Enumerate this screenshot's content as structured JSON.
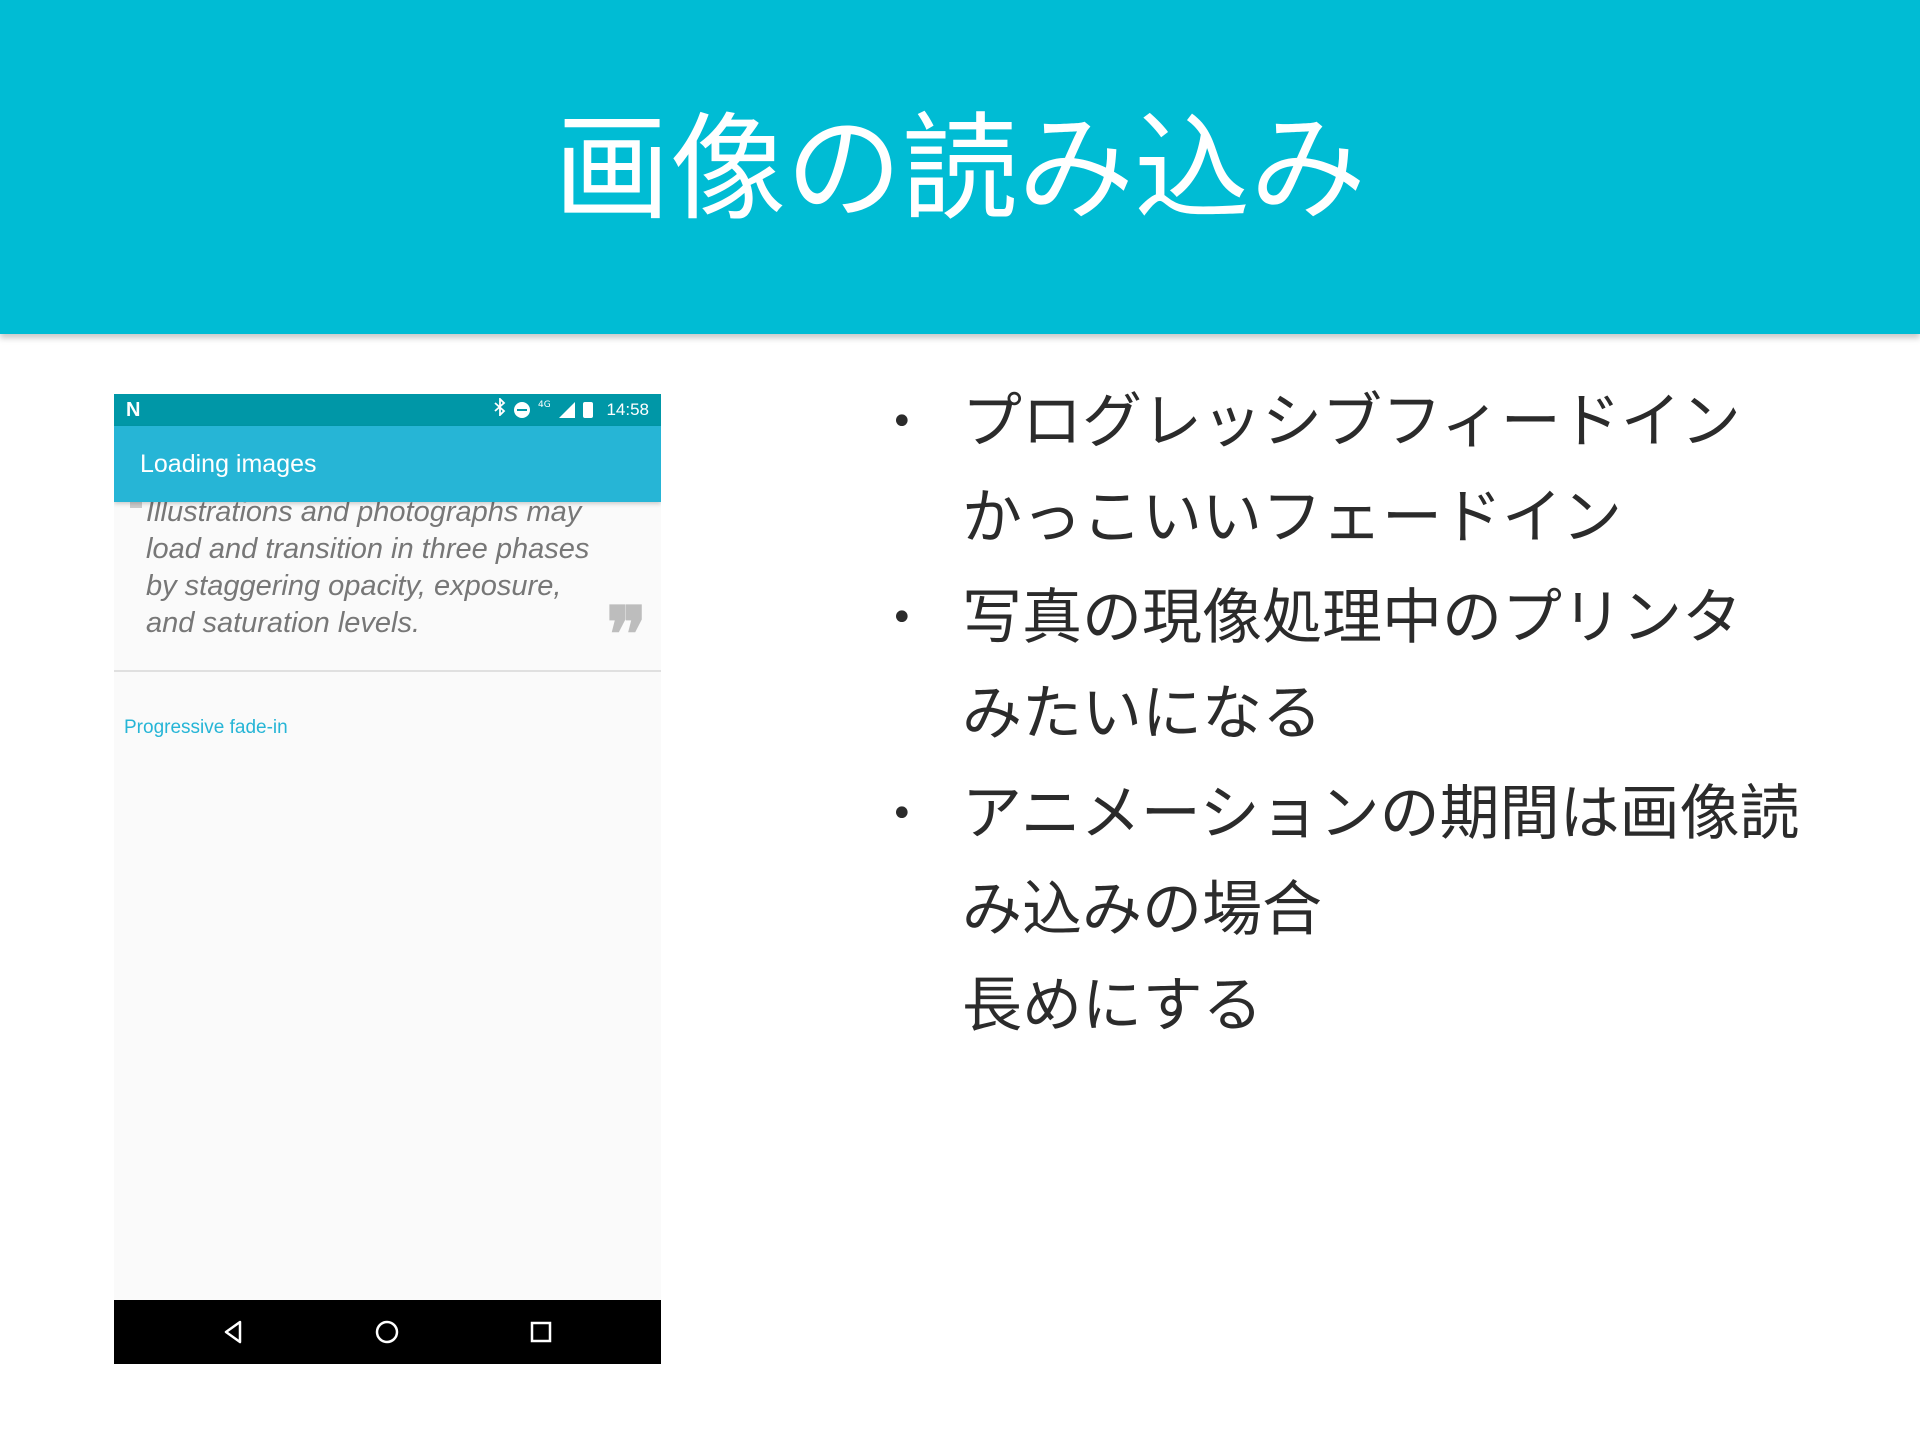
{
  "slide": {
    "title": "画像の読み込み"
  },
  "phone": {
    "status_bar": {
      "carrier_icon": "N",
      "icons": [
        "bluetooth-icon",
        "do-not-disturb-icon",
        "4g-signal-icon",
        "battery-icon"
      ],
      "network_label": "4G",
      "time": "14:58"
    },
    "app_bar": {
      "title": "Loading images"
    },
    "quote": {
      "lines": [
        "Illustrations and photographs may",
        "load and transition in three phases",
        "by staggering opacity, exposure,",
        "and saturation levels."
      ],
      "close_mark": "❞"
    },
    "section_label": "Progressive fade-in",
    "nav_bar": {
      "buttons": [
        "back-icon",
        "home-icon",
        "recents-icon"
      ]
    },
    "colors": {
      "status_bar": "#0097a7",
      "app_bar": "#26b5d6",
      "accent_text": "#26b5d6"
    }
  },
  "bullets": [
    {
      "lines": [
        "プログレッシブフィードイン",
        "かっこいいフェードイン"
      ]
    },
    {
      "lines": [
        "写真の現像処理中のプリンタ",
        "みたいになる"
      ]
    },
    {
      "lines": [
        "アニメーションの期間は画像読",
        "み込みの場合",
        "長めにする"
      ]
    }
  ],
  "colors": {
    "header_background": "#00bcd4",
    "header_text": "#ffffff",
    "body_text": "#2b2b2b"
  }
}
